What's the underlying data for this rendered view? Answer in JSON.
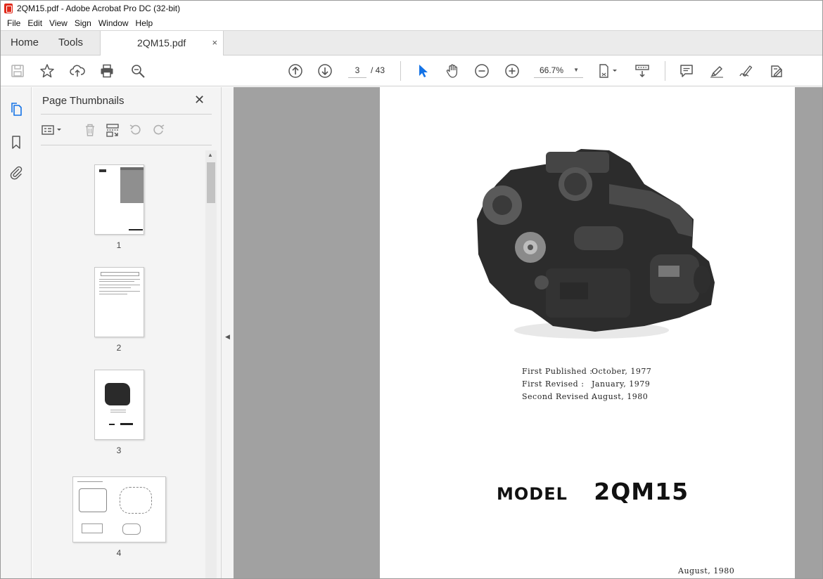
{
  "window": {
    "title": "2QM15.pdf - Adobe Acrobat Pro DC (32-bit)"
  },
  "menu": {
    "items": [
      "File",
      "Edit",
      "View",
      "Sign",
      "Window",
      "Help"
    ]
  },
  "tabs": {
    "home": "Home",
    "tools": "Tools",
    "document": "2QM15.pdf",
    "close": "×"
  },
  "toolbar": {
    "current_page": "3",
    "total_pages": "/ 43",
    "zoom": "66.7%",
    "icons": [
      "save-icon",
      "bookmark-star-icon",
      "cloud-upload-icon",
      "print-icon",
      "search-zoom-icon",
      "prev-page-icon",
      "next-page-icon",
      "select-cursor-icon",
      "hand-tool-icon",
      "zoom-out-icon",
      "zoom-in-icon",
      "page-fit-icon",
      "scroll-mode-icon",
      "comment-icon",
      "highlight-icon",
      "sign-icon",
      "edit-icon"
    ]
  },
  "sidebar": {
    "panel_title": "Page Thumbnails",
    "close": "✕",
    "thumbnails": [
      {
        "label": "1"
      },
      {
        "label": "2"
      },
      {
        "label": "3"
      },
      {
        "label": "4"
      }
    ]
  },
  "document_page": {
    "publication": [
      {
        "label": "First  Published :",
        "value": "October,  1977"
      },
      {
        "label": "First  Revised :",
        "value": "January,  1979"
      },
      {
        "label": "Second  Revised :",
        "value": "August,  1980"
      }
    ],
    "model_word": "MODEL",
    "model_name": "2QM15",
    "footer_date": "August,  1980"
  },
  "colors": {
    "accent": "#1473e6",
    "app_red": "#e02a1b",
    "viewport_bg": "#a1a1a1"
  }
}
